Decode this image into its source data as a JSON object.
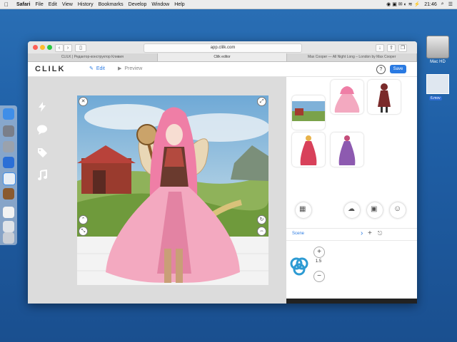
{
  "menubar": {
    "app": "Safari",
    "items": [
      "File",
      "Edit",
      "View",
      "History",
      "Bookmarks",
      "Develop",
      "Window",
      "Help"
    ],
    "clock": "21:46"
  },
  "desktop": {
    "hd_label": "Mac HD",
    "file_label": "6.mov"
  },
  "browser": {
    "url": "app.clilk.com",
    "tabs": [
      "CLILK | Редактор-конструктор Кливия",
      "Clilk editor",
      "Max Cooper — All Night Long – London by Max Cooper"
    ]
  },
  "app": {
    "logo": "CLILK",
    "edit_label": "Edit",
    "preview_label": "Preview",
    "help_label": "?",
    "save_label": "Save",
    "scene_label": "Scene",
    "zoom_value": "1.5",
    "close_label": "✕"
  },
  "colors": {
    "accent": "#2a7ae2",
    "canvas_bg": "#dcdcdc"
  }
}
